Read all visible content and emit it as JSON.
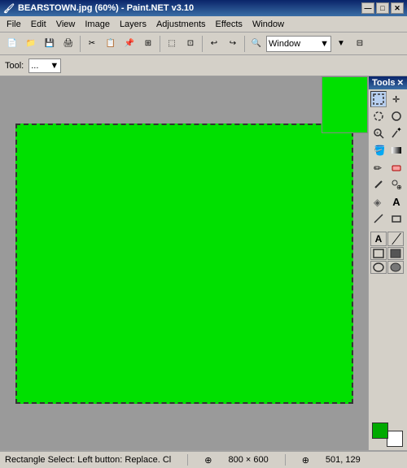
{
  "titlebar": {
    "title": "BEARSTOWN.jpg (60%) - Paint.NET v3.10",
    "icon": "🖼",
    "min_btn": "—",
    "max_btn": "□",
    "close_btn": "✕"
  },
  "menubar": {
    "items": [
      "File",
      "Edit",
      "View",
      "Image",
      "Layers",
      "Adjustments",
      "Effects",
      "Window"
    ]
  },
  "toolbar": {
    "window_label": "Window",
    "window_value": "Window"
  },
  "toolopts": {
    "label": "Tool:",
    "dropdown_value": "..."
  },
  "tools": {
    "title": "Tools",
    "items": [
      {
        "name": "rect-select",
        "icon": "⬚",
        "active": true
      },
      {
        "name": "move",
        "icon": "✛"
      },
      {
        "name": "lasso",
        "icon": "⊙"
      },
      {
        "name": "ellipse-select",
        "icon": "◯"
      },
      {
        "name": "zoom",
        "icon": "🔍"
      },
      {
        "name": "magic-wand",
        "icon": "✦"
      },
      {
        "name": "paint-bucket",
        "icon": "⬡"
      },
      {
        "name": "gradient",
        "icon": "▦"
      },
      {
        "name": "paintbrush",
        "icon": "✏"
      },
      {
        "name": "eraser",
        "icon": "▭"
      },
      {
        "name": "pencil",
        "icon": "✎"
      },
      {
        "name": "clone-stamp",
        "icon": "⊕"
      },
      {
        "name": "recolor",
        "icon": "◈"
      },
      {
        "name": "text",
        "icon": "A"
      },
      {
        "name": "line",
        "icon": "╱"
      },
      {
        "name": "shapes",
        "icon": "■"
      }
    ]
  },
  "statusbar": {
    "tool_info": "Rectangle Select: Left button: Replace. Cl",
    "cursor_icon": "⊕",
    "dimensions": "800 × 600",
    "coords_icon": "⊕",
    "coordinates": "501, 129"
  },
  "canvas": {
    "color": "#00e000"
  }
}
